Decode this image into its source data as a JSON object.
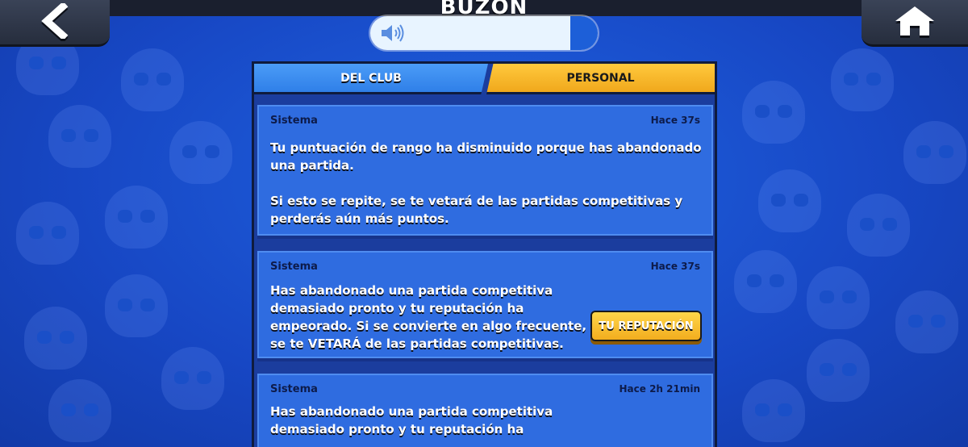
{
  "header": {
    "title": "BUZÓN",
    "back_icon": "chevron-left-icon",
    "home_icon": "home-icon",
    "volume_icon": "speaker-icon",
    "volume_level": 0.12
  },
  "tabs": [
    {
      "label": "DEL CLUB",
      "active": false
    },
    {
      "label": "PERSONAL",
      "active": true
    }
  ],
  "messages": [
    {
      "sender": "Sistema",
      "time": "Hace 37s",
      "body": "Tu puntuación de rango ha disminuido porque has abandonado\nuna partida.\n\nSi esto se repite, se te vetará de las partidas competitivas y\nperderás aún más puntos."
    },
    {
      "sender": "Sistema",
      "time": "Hace 37s",
      "body": "Has abandonado una partida competitiva\ndemasiado pronto y tu reputación ha\nempeorado. Si se convierte en algo frecuente,\nse te VETARÁ de las partidas competitivas.",
      "button_label": "TU REPUTACIÓN"
    },
    {
      "sender": "Sistema",
      "time": "Hace 2h 21min",
      "body": "Has abandonado una partida competitiva\ndemasiado pronto y tu reputación ha"
    }
  ],
  "colors": {
    "background": "#1747c4",
    "tab_active": "#f0a81c",
    "tab_inactive": "#2f7fe8",
    "message_bg": "#2f6ce0",
    "button": "#f2ad1e"
  }
}
